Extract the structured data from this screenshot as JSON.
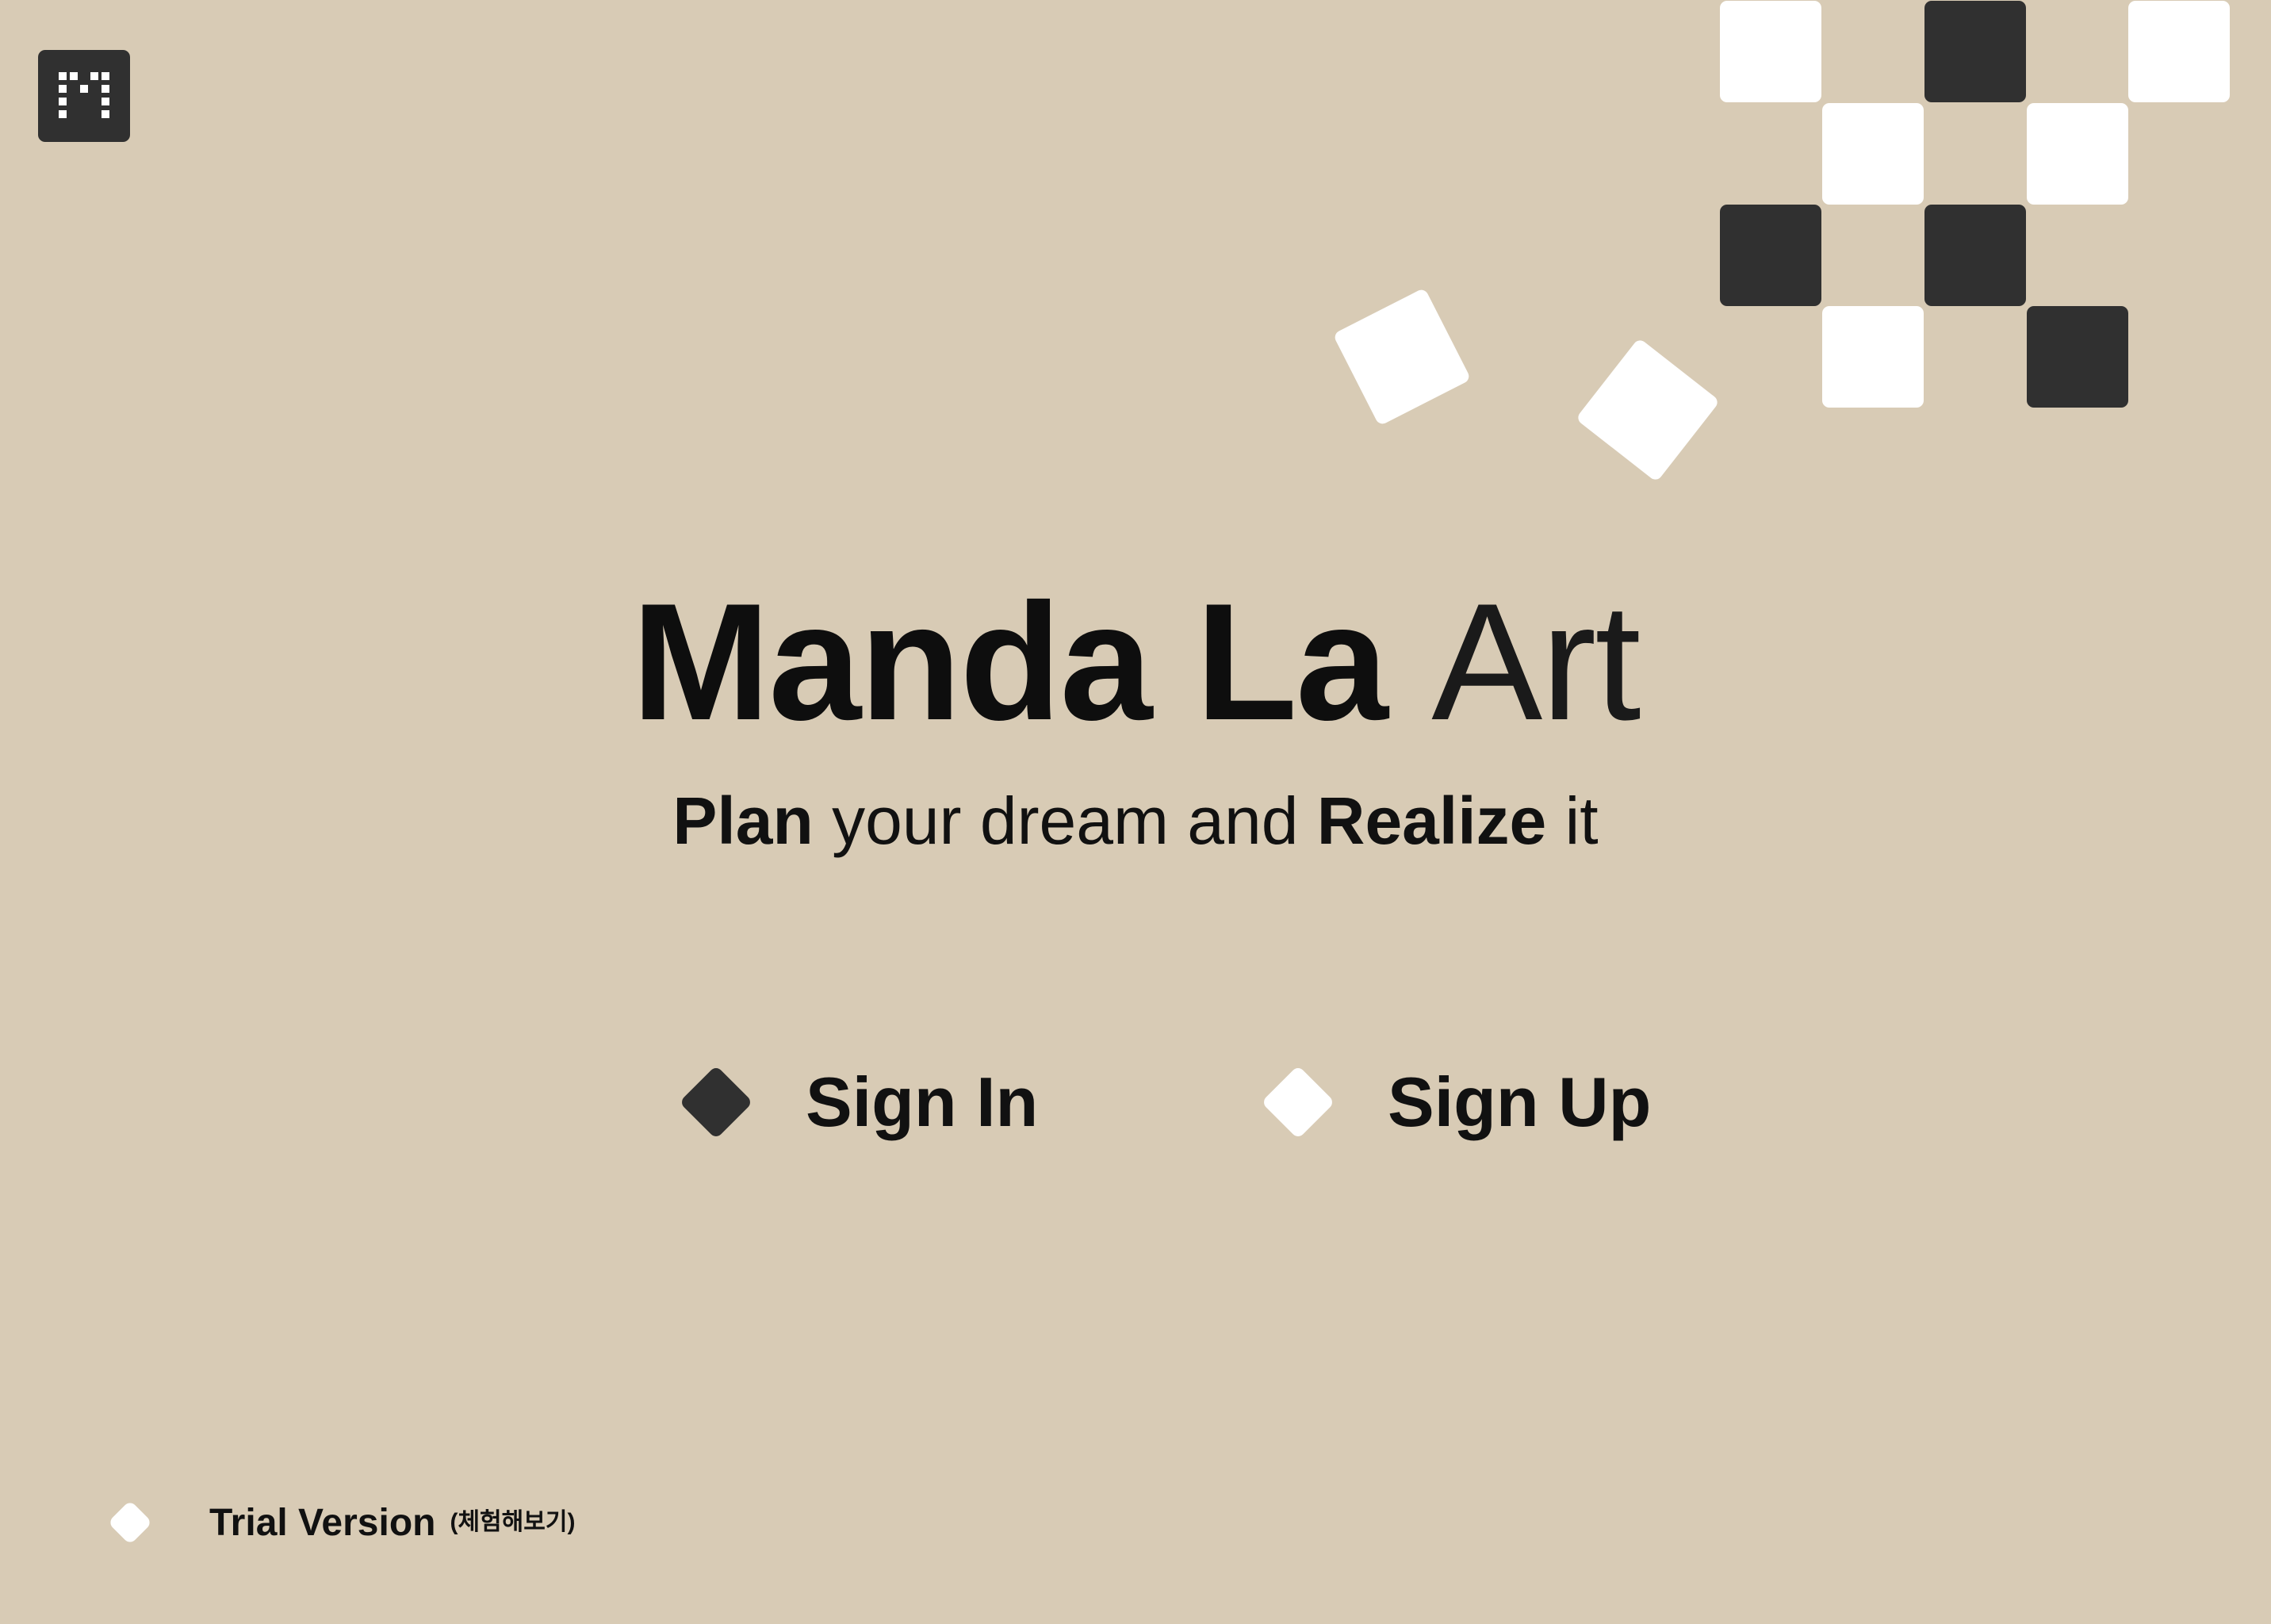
{
  "app": {
    "logo_icon": "pixel-m-logo-icon"
  },
  "hero": {
    "title_bold": "Manda La",
    "title_light": "Art",
    "tagline": {
      "w1": "Plan",
      "w2": "your dream and",
      "w3": "Realize",
      "w4": "it"
    }
  },
  "actions": {
    "sign_in_label": "Sign In",
    "sign_up_label": "Sign Up",
    "trial_label": "Trial Version",
    "trial_sub": "(체험해보기)"
  },
  "colors": {
    "background": "#d8cbb5",
    "dark": "#303030",
    "light": "#ffffff",
    "text": "#0e0e0e"
  }
}
